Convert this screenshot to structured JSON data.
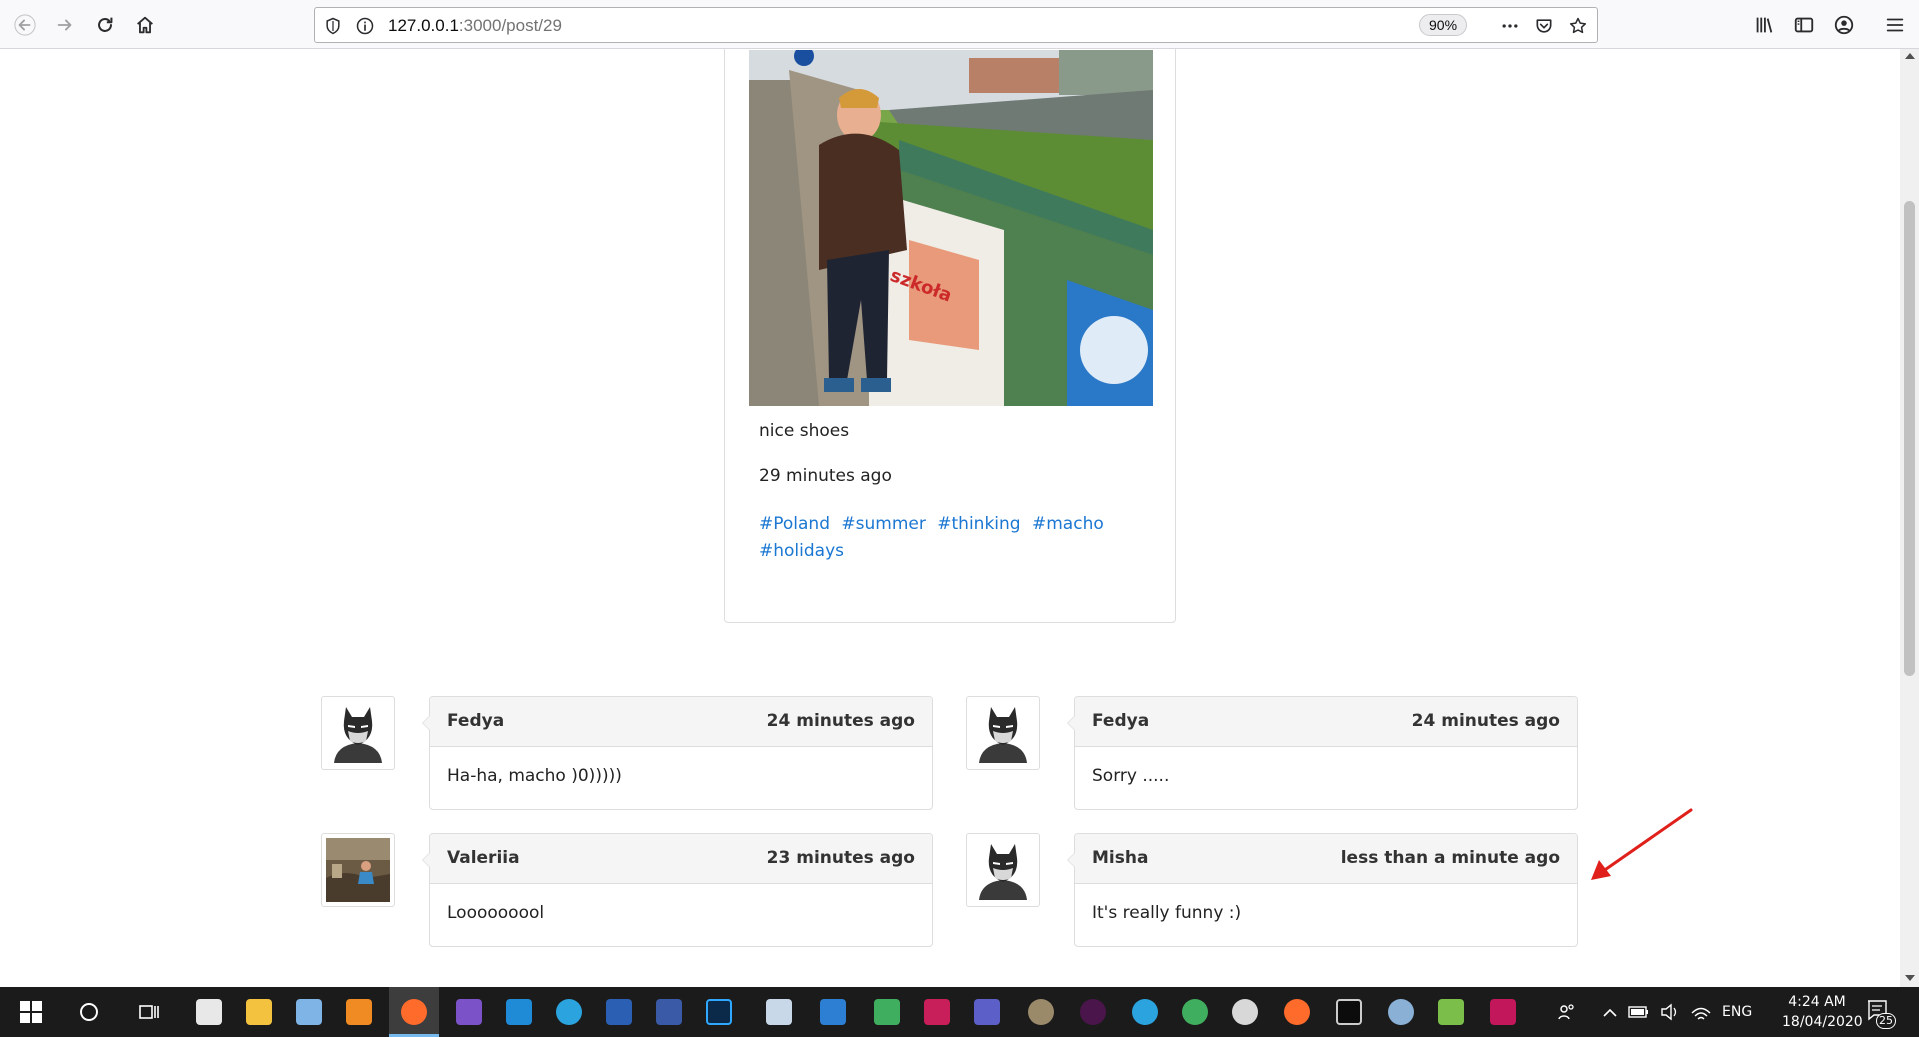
{
  "browser": {
    "url_host": "127.0.0.1",
    "url_path": ":3000/post/29",
    "zoom": "90%",
    "menu_dots": "•••"
  },
  "post": {
    "caption": "nice shoes",
    "time": "29 minutes ago",
    "tags": [
      "#Poland",
      "#summer",
      "#thinking",
      "#macho",
      "#holidays"
    ]
  },
  "comments": [
    {
      "author": "Fedya",
      "time": "24 minutes ago",
      "text": "Ha-ha, macho )0)))))",
      "avatar": "batman-avatar"
    },
    {
      "author": "Fedya",
      "time": "24 minutes ago",
      "text": "Sorry .....",
      "avatar": "batman-avatar"
    },
    {
      "author": "Valeriia",
      "time": "23 minutes ago",
      "text": "Looooooool",
      "avatar": "photo-avatar"
    },
    {
      "author": "Misha",
      "time": "less than a minute ago",
      "text": "It's really funny :)",
      "avatar": "batman-avatar"
    }
  ],
  "annotation": {
    "color": "#e0201a"
  },
  "taskbar": {
    "lang": "ENG",
    "time": "4:24 AM",
    "date": "18/04/2020",
    "notifications": "25"
  }
}
